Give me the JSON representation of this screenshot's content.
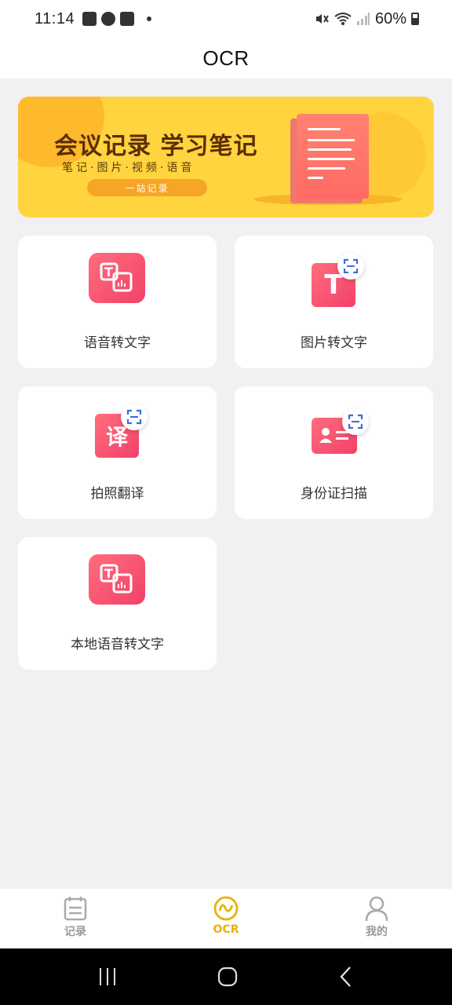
{
  "status_bar": {
    "time": "11:14",
    "battery": "60%"
  },
  "app_bar": {
    "title": "OCR"
  },
  "banner": {
    "headline": "会议记录 学习笔记",
    "subtitle": "笔记·图片·视频·语音",
    "pill": "一站记录"
  },
  "features": [
    {
      "label": "语音转文字",
      "icon": "speech-to-text-icon"
    },
    {
      "label": "图片转文字",
      "icon": "image-to-text-icon"
    },
    {
      "label": "拍照翻译",
      "icon": "photo-translate-icon"
    },
    {
      "label": "身份证扫描",
      "icon": "id-card-scan-icon"
    },
    {
      "label": "本地语音转文字",
      "icon": "local-speech-to-text-icon"
    }
  ],
  "tabs": [
    {
      "label": "记录",
      "icon": "notepad-icon",
      "active": false
    },
    {
      "label": "OCR",
      "icon": "ocr-wave-icon",
      "active": true
    },
    {
      "label": "我的",
      "icon": "user-icon",
      "active": false
    }
  ],
  "colors": {
    "accent": "#e5b30b",
    "feature_icon": "#f2416a",
    "banner": "#ffd43f"
  }
}
